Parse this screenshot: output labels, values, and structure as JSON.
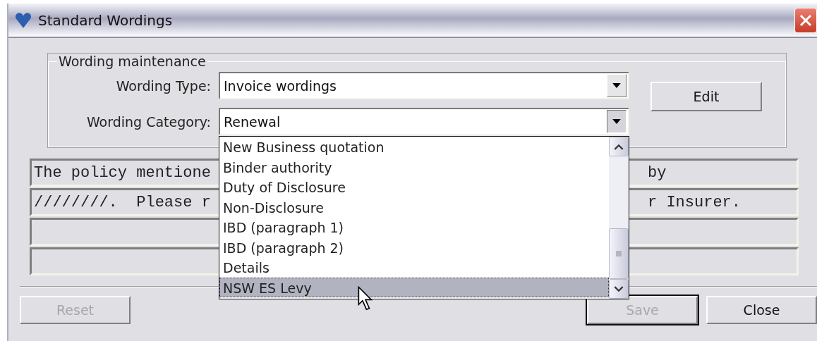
{
  "window": {
    "title": "Standard Wordings"
  },
  "group": {
    "title": "Wording maintenance",
    "fields": [
      {
        "label": "Wording Type:",
        "value": "Invoice wordings",
        "expanded": false
      },
      {
        "label": "Wording Category:",
        "value": "Renewal",
        "expanded": true
      }
    ],
    "edit_button": {
      "label": "Edit",
      "disabled": false
    }
  },
  "dropdown": {
    "items": [
      {
        "label": "New Business quotation",
        "selected": false
      },
      {
        "label": "Binder authority",
        "selected": false
      },
      {
        "label": "Duty of Disclosure",
        "selected": false
      },
      {
        "label": "Non-Disclosure",
        "selected": false
      },
      {
        "label": "IBD (paragraph 1)",
        "selected": false
      },
      {
        "label": "IBD (paragraph 2)",
        "selected": false
      },
      {
        "label": "Details",
        "selected": false
      },
      {
        "label": "NSW ES Levy",
        "selected": true
      }
    ]
  },
  "lines": [
    {
      "kind": "text",
      "left": "The policy mentione",
      "right": "by"
    },
    {
      "kind": "text",
      "left": "////////.  Please r",
      "right": "r Insurer."
    },
    {
      "kind": "blank"
    },
    {
      "kind": "blank"
    }
  ],
  "buttons": [
    {
      "label": "Reset",
      "disabled": true,
      "default": false
    },
    {
      "label": "Save",
      "disabled": true,
      "default": true
    },
    {
      "label": "Close",
      "disabled": false,
      "default": false
    }
  ]
}
